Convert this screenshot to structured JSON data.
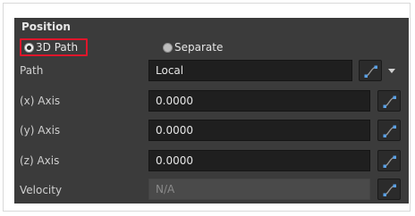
{
  "section": {
    "title": "Position"
  },
  "mode": {
    "options": [
      {
        "label": "3D Path",
        "selected": true
      },
      {
        "label": "Separate",
        "selected": false
      }
    ]
  },
  "rows": {
    "path": {
      "label": "Path",
      "value": "Local"
    },
    "x_axis": {
      "label": "(x) Axis",
      "value": "0.0000"
    },
    "y_axis": {
      "label": "(y) Axis",
      "value": "0.0000"
    },
    "z_axis": {
      "label": "(z) Axis",
      "value": "0.0000"
    },
    "velocity": {
      "label": "Velocity",
      "value": "N/A",
      "disabled": true
    }
  },
  "icons": {
    "function_button": "function-curve-icon",
    "dropdown": "chevron-down-icon"
  },
  "colors": {
    "panel_bg": "#3b3b3b",
    "field_bg": "#1f1f1f",
    "highlight": "#e0162b",
    "icon_accent": "#5aa0e6"
  }
}
